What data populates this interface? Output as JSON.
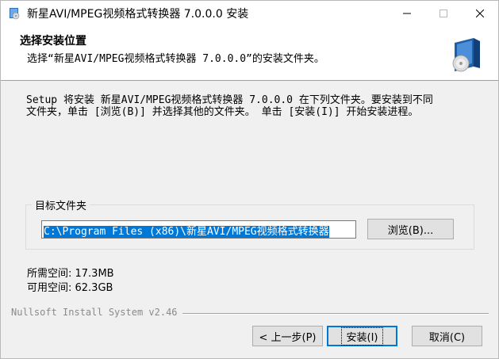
{
  "window": {
    "title": "新星AVI/MPEG视频格式转换器 7.0.0.0 安装"
  },
  "header": {
    "title": "选择安装位置",
    "subtitle": "选择“新星AVI/MPEG视频格式转换器 7.0.0.0”的安装文件夹。"
  },
  "intro": {
    "line1": "Setup 将安装 新星AVI/MPEG视频格式转换器 7.0.0.0 在下列文件夹。要安装到不同",
    "line2": "文件夹，单击 [浏览(B)] 并选择其他的文件夹。 单击 [安装(I)] 开始安装进程。"
  },
  "destination": {
    "group_label": "目标文件夹",
    "path": "C:\\Program Files (x86)\\新星AVI/MPEG视频格式转换器",
    "browse_label": "浏览(B)..."
  },
  "space": {
    "required": "所需空间: 17.3MB",
    "available": "可用空间: 62.3GB"
  },
  "branding": "Nullsoft Install System v2.46",
  "buttons": {
    "back": "< 上一步(P)",
    "install": "安装(I)",
    "cancel": "取消(C)"
  },
  "icons": {
    "app": "installer-icon",
    "header": "disc-box-icon",
    "minimize": "minimize-icon",
    "maximize": "maximize-icon",
    "close": "close-icon"
  },
  "colors": {
    "selection": "#0078d7",
    "default_button_border": "#0078d7"
  }
}
